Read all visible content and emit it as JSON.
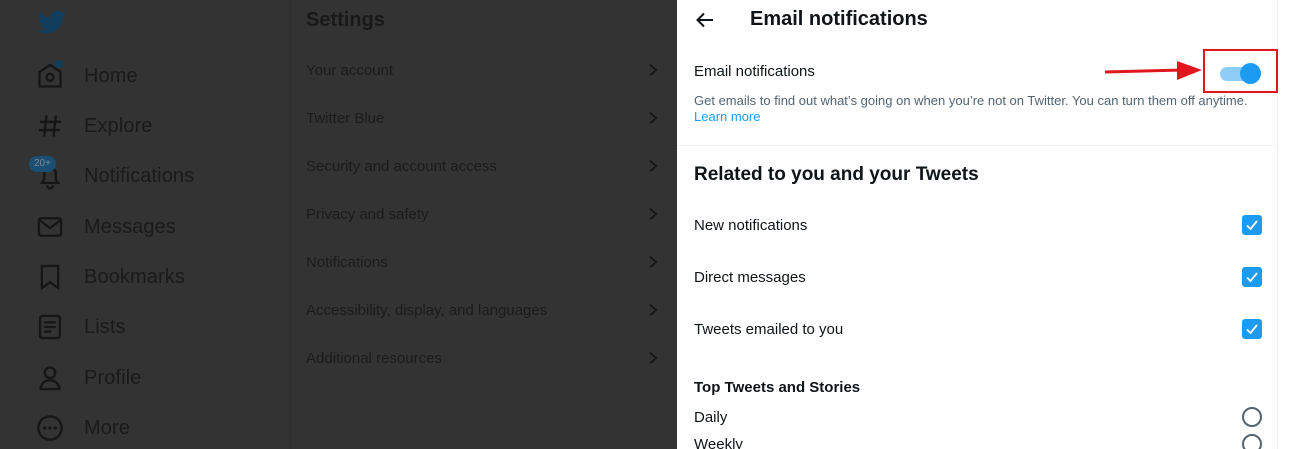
{
  "nav": {
    "items": [
      {
        "label": "Home",
        "icon": "home-icon"
      },
      {
        "label": "Explore",
        "icon": "hashtag-icon"
      },
      {
        "label": "Notifications",
        "icon": "bell-icon",
        "badge": "20+"
      },
      {
        "label": "Messages",
        "icon": "envelope-icon"
      },
      {
        "label": "Bookmarks",
        "icon": "bookmark-icon"
      },
      {
        "label": "Lists",
        "icon": "list-icon"
      },
      {
        "label": "Profile",
        "icon": "person-icon"
      },
      {
        "label": "More",
        "icon": "more-circle-icon"
      }
    ]
  },
  "settings": {
    "title": "Settings",
    "items": [
      {
        "label": "Your account"
      },
      {
        "label": "Twitter Blue"
      },
      {
        "label": "Security and account access"
      },
      {
        "label": "Privacy and safety"
      },
      {
        "label": "Notifications"
      },
      {
        "label": "Accessibility, display, and languages"
      },
      {
        "label": "Additional resources"
      }
    ]
  },
  "panel": {
    "title": "Email notifications",
    "email_toggle": {
      "label": "Email notifications",
      "checked": true,
      "description": "Get emails to find out what’s going on when you’re not on Twitter. You can turn them off anytime.",
      "learn_more": "Learn more"
    },
    "section_title": "Related to you and your Tweets",
    "checkboxes": [
      {
        "label": "New notifications",
        "checked": true
      },
      {
        "label": "Direct messages",
        "checked": true
      },
      {
        "label": "Tweets emailed to you",
        "checked": true
      }
    ],
    "top_tweets": {
      "title": "Top Tweets and Stories",
      "options": [
        {
          "label": "Daily",
          "selected": false
        },
        {
          "label": "Weekly",
          "selected": false
        }
      ]
    }
  },
  "colors": {
    "accent": "#1d9bf0",
    "overlay": "#333333",
    "highlight": "#e0171f"
  }
}
